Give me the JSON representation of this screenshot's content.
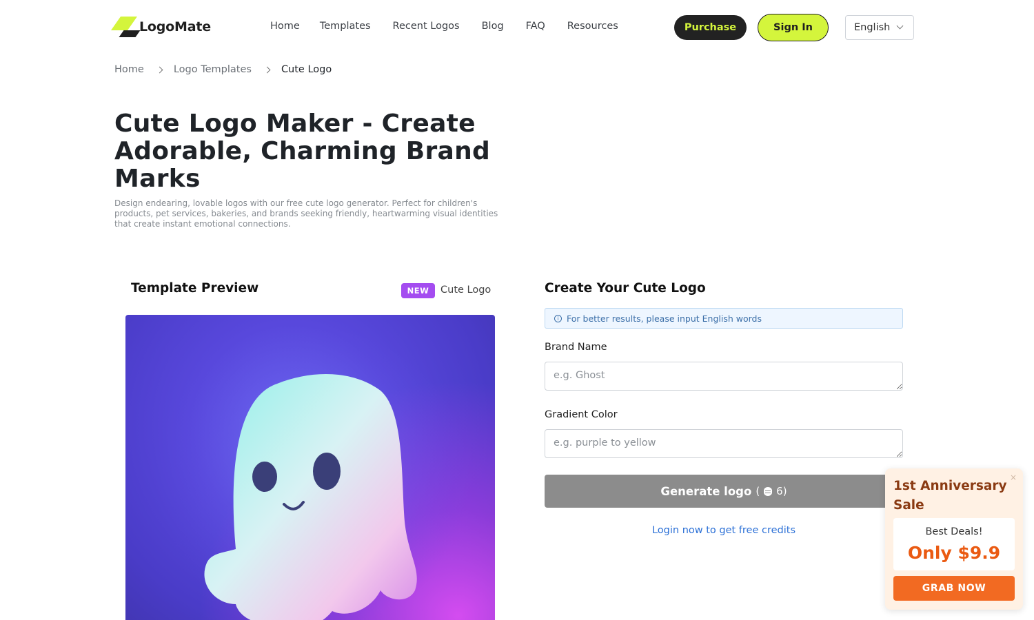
{
  "header": {
    "logo_text": "LogoMate",
    "nav": [
      "Home",
      "Templates",
      "Recent Logos",
      "Blog",
      "FAQ",
      "Resources"
    ],
    "purchase_label": "Purchase",
    "signin_label": "Sign In",
    "language": "English"
  },
  "breadcrumb": [
    "Home",
    "Logo Templates",
    "Cute Logo"
  ],
  "hero": {
    "title": "Cute Logo Maker - Create Adorable, Charming Brand Marks",
    "description": "Design endearing, lovable logos with our free cute logo generator. Perfect for children's products, pet services, bakeries, and brands seeking friendly, heartwarming visual identities that create instant emotional connections."
  },
  "preview": {
    "title": "Template Preview",
    "badge": "NEW",
    "template_name": "Cute Logo",
    "image_subject": "ghost-mascot"
  },
  "form": {
    "title": "Create Your Cute Logo",
    "info": "For better results, please input English words",
    "brand_label": "Brand Name",
    "brand_placeholder": "e.g. Ghost",
    "gradient_label": "Gradient Color",
    "gradient_placeholder": "e.g. purple to yellow",
    "generate_label": "Generate logo",
    "credits_open": "(",
    "credits_value": "6)",
    "login_link": "Login now to get free credits"
  },
  "sale": {
    "title": "1st Anniversary Sale",
    "deal": "Best Deals!",
    "price": "Only $9.9",
    "button": "GRAB NOW",
    "close": "×"
  },
  "colors": {
    "accent": "#d4f53c",
    "dark": "#222222",
    "badge": "#a44cf0",
    "sale_button": "#f26a22",
    "link": "#2a6fd6"
  }
}
